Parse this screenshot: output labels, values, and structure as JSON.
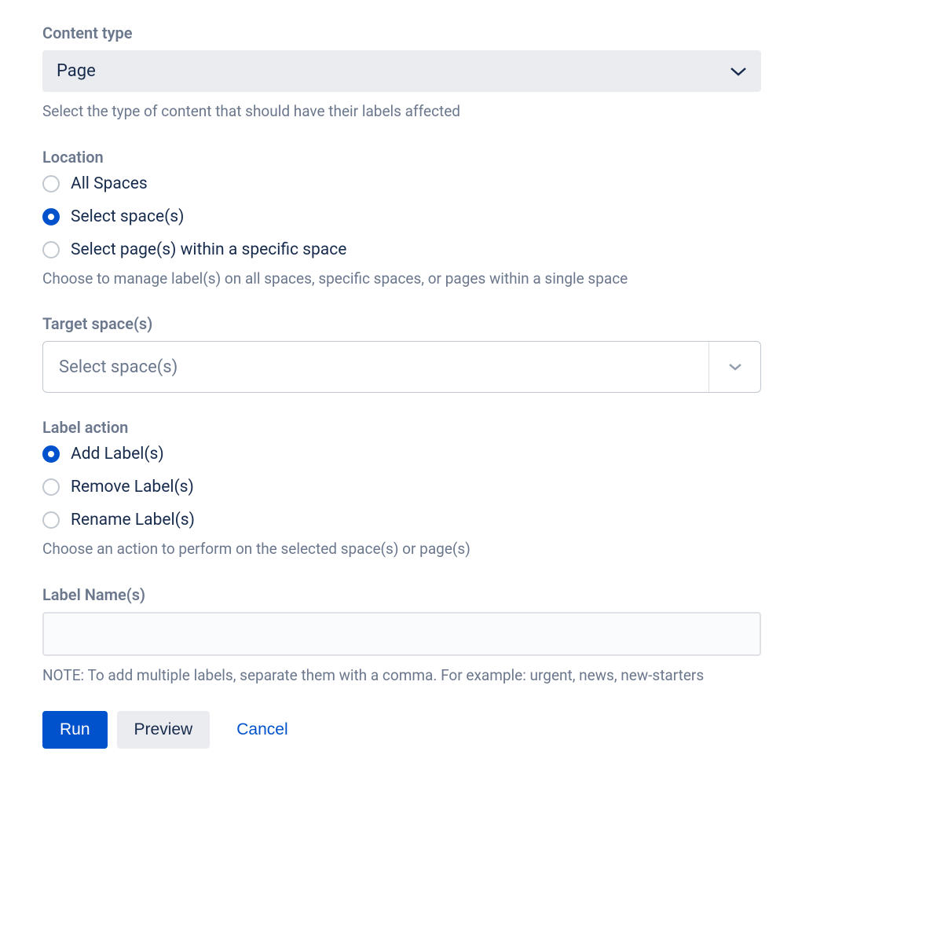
{
  "contentType": {
    "label": "Content type",
    "value": "Page",
    "helper": "Select the type of content that should have their labels affected"
  },
  "location": {
    "label": "Location",
    "options": [
      {
        "label": "All Spaces",
        "checked": false
      },
      {
        "label": "Select space(s)",
        "checked": true
      },
      {
        "label": "Select page(s) within a specific space",
        "checked": false
      }
    ],
    "helper": "Choose to manage label(s) on all spaces, specific spaces, or pages within a single space"
  },
  "targetSpaces": {
    "label": "Target space(s)",
    "placeholder": "Select space(s)"
  },
  "labelAction": {
    "label": "Label action",
    "options": [
      {
        "label": "Add Label(s)",
        "checked": true
      },
      {
        "label": "Remove Label(s)",
        "checked": false
      },
      {
        "label": "Rename Label(s)",
        "checked": false
      }
    ],
    "helper": "Choose an action to perform on the selected space(s) or page(s)"
  },
  "labelNames": {
    "label": "Label Name(s)",
    "value": "",
    "helper": "NOTE: To add multiple labels, separate them with a comma. For example: urgent, news, new-starters"
  },
  "buttons": {
    "run": "Run",
    "preview": "Preview",
    "cancel": "Cancel"
  }
}
